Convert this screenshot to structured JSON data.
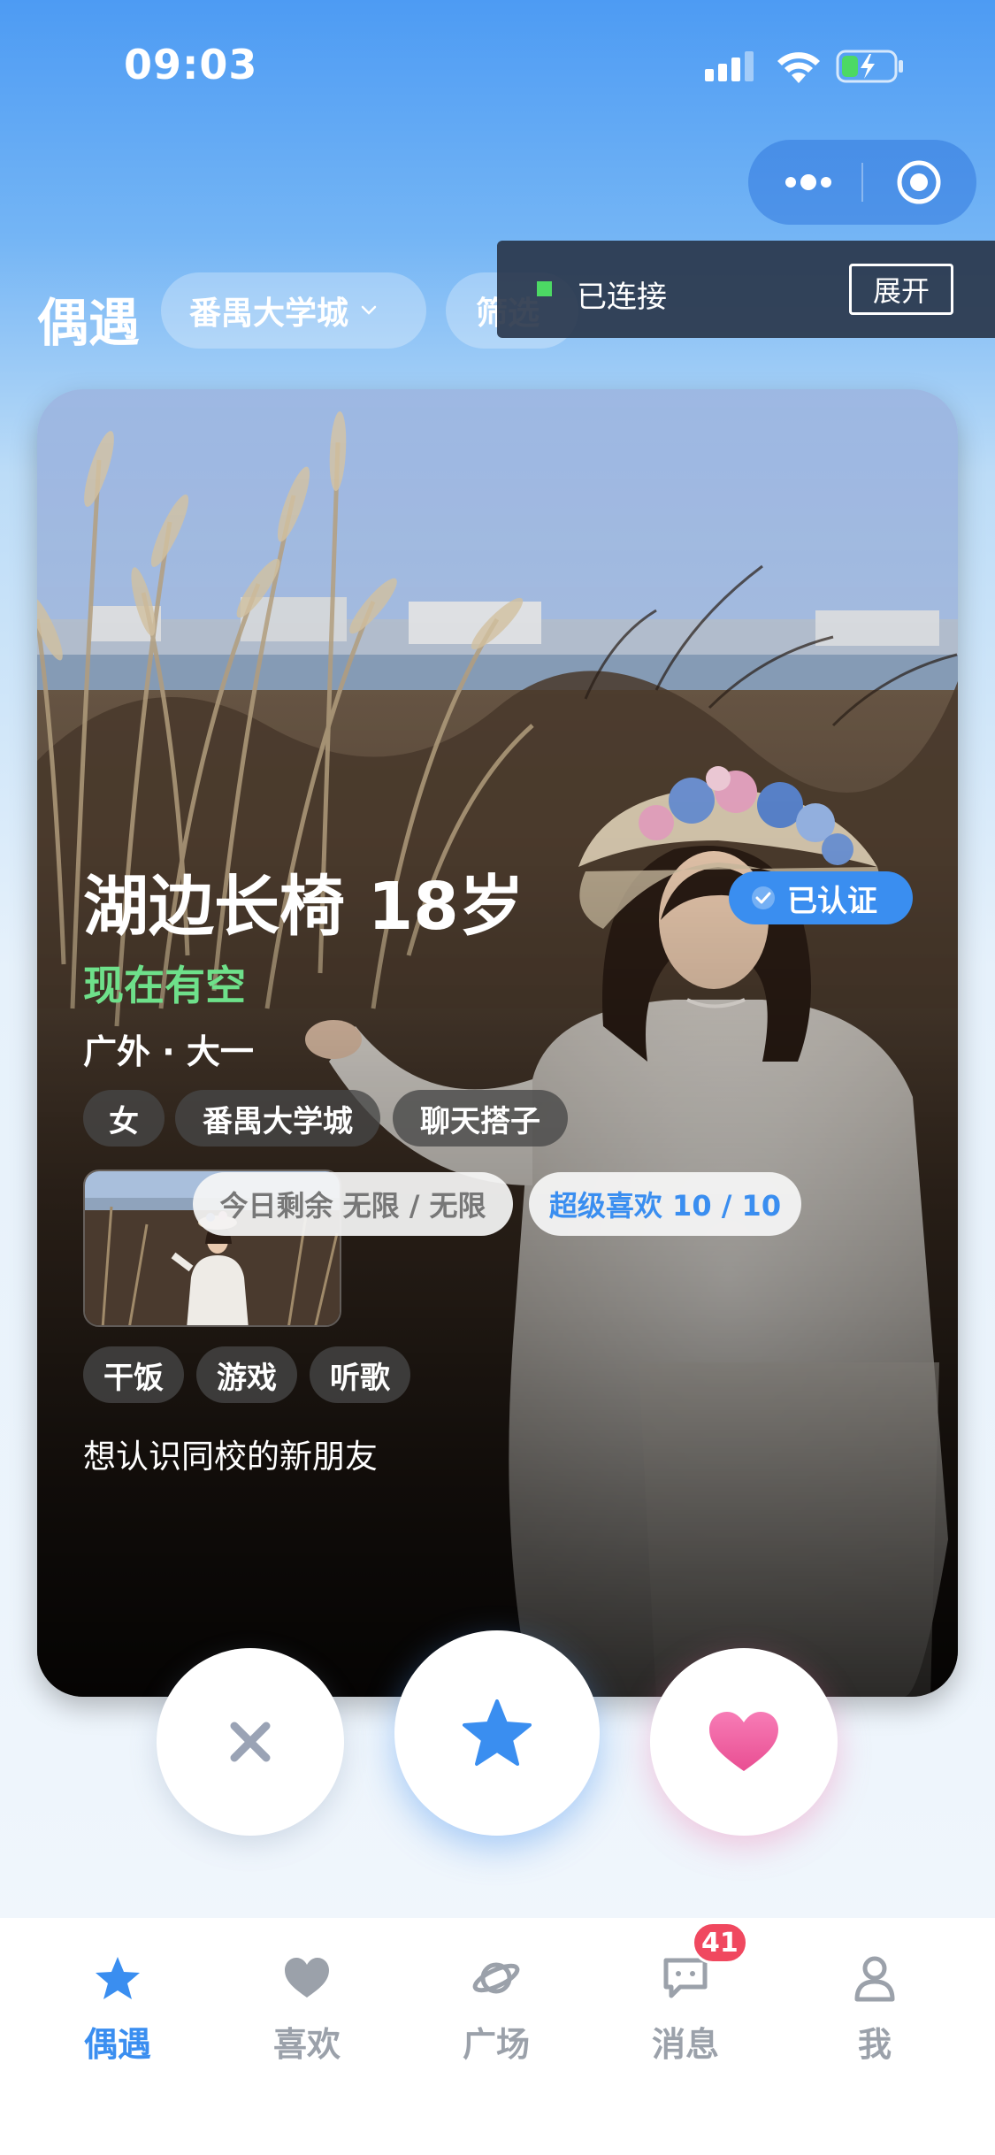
{
  "status_bar": {
    "time": "09:03"
  },
  "header": {
    "title": "偶遇",
    "location": "番禺大学城",
    "filter": "筛选"
  },
  "debug_banner": {
    "status": "已连接",
    "expand": "展开"
  },
  "profile": {
    "name_age": "湖边长椅 18岁",
    "verified": "已认证",
    "availability": "现在有空",
    "meta": "广外 · 大一",
    "tags": [
      "女",
      "番禺大学城",
      "聊天搭子"
    ],
    "interests": [
      "干饭",
      "游戏",
      "听歌"
    ],
    "bio": "想认识同校的新朋友"
  },
  "quota": {
    "daily": "今日剩余 无限 / 无限",
    "super_like": "超级喜欢 10 / 10"
  },
  "tabbar": {
    "items": [
      {
        "label": "偶遇",
        "icon": "star-icon",
        "active": true
      },
      {
        "label": "喜欢",
        "icon": "heart-icon",
        "active": false
      },
      {
        "label": "广场",
        "icon": "planet-icon",
        "active": false
      },
      {
        "label": "消息",
        "icon": "chat-icon",
        "active": false,
        "badge": "41"
      },
      {
        "label": "我",
        "icon": "user-icon",
        "active": false
      }
    ]
  },
  "colors": {
    "accent": "#3a8ef0",
    "available": "#6ee08a",
    "like": "#f25c9e",
    "badge": "#f0485f"
  }
}
